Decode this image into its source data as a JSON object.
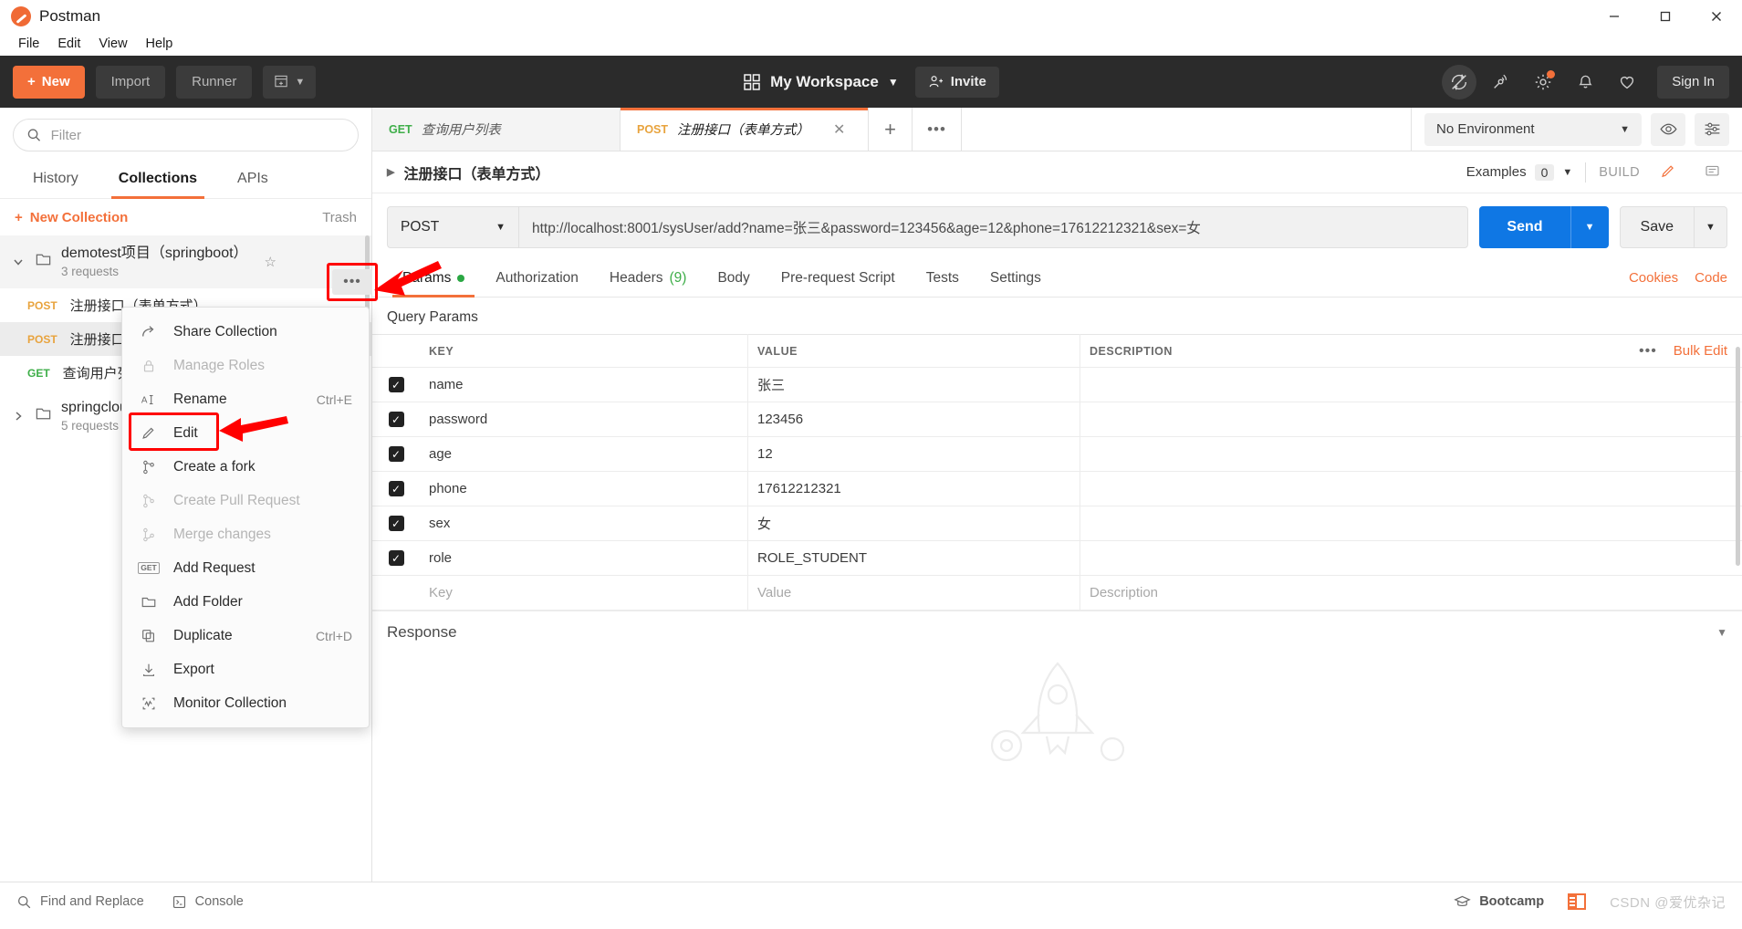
{
  "window": {
    "app_title": "Postman",
    "controls": {
      "minimize": "minimize-icon",
      "maximize": "maximize-icon",
      "close": "close-icon"
    }
  },
  "menubar": {
    "items": [
      "File",
      "Edit",
      "View",
      "Help"
    ]
  },
  "toolbar": {
    "new_label": "New",
    "import_label": "Import",
    "runner_label": "Runner",
    "workspace_label": "My Workspace",
    "invite_label": "Invite",
    "signin_label": "Sign In",
    "icons": [
      "sync-off-icon",
      "satellite-icon",
      "gear-icon",
      "bell-icon",
      "heart-icon"
    ]
  },
  "sidebar": {
    "filter_placeholder": "Filter",
    "tabs": [
      {
        "label": "History",
        "active": false
      },
      {
        "label": "Collections",
        "active": true
      },
      {
        "label": "APIs",
        "active": false
      }
    ],
    "new_collection_label": "New Collection",
    "trash_label": "Trash",
    "collections": [
      {
        "name": "demotest项目（springboot）",
        "requests_count": "3 requests",
        "expanded": true,
        "items": [
          {
            "method": "POST",
            "name": "注册接口（表单方式）"
          },
          {
            "method": "POST",
            "name": "注册接口（json方式）"
          },
          {
            "method": "GET",
            "name": "查询用户列表"
          }
        ]
      },
      {
        "name": "springcloud项目",
        "requests_count": "5 requests",
        "expanded": false,
        "items": []
      }
    ]
  },
  "context_menu": {
    "items": [
      {
        "label": "Share Collection",
        "icon": "share-icon",
        "shortcut": "",
        "disabled": false,
        "highlighted": false
      },
      {
        "label": "Manage Roles",
        "icon": "lock-icon",
        "shortcut": "",
        "disabled": true,
        "highlighted": false
      },
      {
        "label": "Rename",
        "icon": "text-cursor-icon",
        "shortcut": "Ctrl+E",
        "disabled": false,
        "highlighted": false
      },
      {
        "label": "Edit",
        "icon": "pencil-icon",
        "shortcut": "",
        "disabled": false,
        "highlighted": true
      },
      {
        "label": "Create a fork",
        "icon": "fork-icon",
        "shortcut": "",
        "disabled": false,
        "highlighted": false
      },
      {
        "label": "Create Pull Request",
        "icon": "pull-request-icon",
        "shortcut": "",
        "disabled": true,
        "highlighted": false
      },
      {
        "label": "Merge changes",
        "icon": "merge-icon",
        "shortcut": "",
        "disabled": true,
        "highlighted": false
      },
      {
        "label": "Add Request",
        "icon": "get-badge-icon",
        "shortcut": "",
        "disabled": false,
        "highlighted": false
      },
      {
        "label": "Add Folder",
        "icon": "folder-icon",
        "shortcut": "",
        "disabled": false,
        "highlighted": false
      },
      {
        "label": "Duplicate",
        "icon": "copy-icon",
        "shortcut": "Ctrl+D",
        "disabled": false,
        "highlighted": false
      },
      {
        "label": "Export",
        "icon": "download-icon",
        "shortcut": "",
        "disabled": false,
        "highlighted": false
      },
      {
        "label": "Monitor Collection",
        "icon": "monitor-icon",
        "shortcut": "",
        "disabled": false,
        "highlighted": false
      }
    ]
  },
  "main": {
    "request_tabs": [
      {
        "method": "GET",
        "name": "查询用户列表",
        "active": false,
        "closable": false
      },
      {
        "method": "POST",
        "name": "注册接口（表单方式）",
        "active": true,
        "closable": true
      }
    ],
    "add_tab_label": "+",
    "tab_more_label": "•••",
    "environment": {
      "selected": "No Environment"
    },
    "env_icons": [
      "eye-icon",
      "sliders-icon"
    ],
    "breadcrumb": {
      "title": "注册接口（表单方式）"
    },
    "examples": {
      "label": "Examples",
      "count": "0"
    },
    "build_label": "BUILD",
    "request": {
      "method": "POST",
      "url": "http://localhost:8001/sysUser/add?name=张三&password=123456&age=12&phone=17612212321&sex=女",
      "send_label": "Send",
      "save_label": "Save"
    },
    "sub_tabs": [
      {
        "label": "Params",
        "badge": "dot",
        "active": true
      },
      {
        "label": "Authorization",
        "badge": "",
        "active": false
      },
      {
        "label": "Headers",
        "badge": "(9)",
        "active": false
      },
      {
        "label": "Body",
        "badge": "",
        "active": false
      },
      {
        "label": "Pre-request Script",
        "badge": "",
        "active": false
      },
      {
        "label": "Tests",
        "badge": "",
        "active": false
      },
      {
        "label": "Settings",
        "badge": "",
        "active": false
      }
    ],
    "sub_tabs_right": [
      "Cookies",
      "Code"
    ],
    "query_params": {
      "section_title": "Query Params",
      "columns": [
        "KEY",
        "VALUE",
        "DESCRIPTION"
      ],
      "bulk_edit_label": "Bulk Edit",
      "more_label": "•••",
      "rows": [
        {
          "checked": true,
          "key": "name",
          "value": "张三",
          "description": ""
        },
        {
          "checked": true,
          "key": "password",
          "value": "123456",
          "description": ""
        },
        {
          "checked": true,
          "key": "age",
          "value": "12",
          "description": ""
        },
        {
          "checked": true,
          "key": "phone",
          "value": "17612212321",
          "description": ""
        },
        {
          "checked": true,
          "key": "sex",
          "value": "女",
          "description": ""
        },
        {
          "checked": true,
          "key": "role",
          "value": "ROLE_STUDENT",
          "description": ""
        }
      ],
      "empty_row": {
        "key": "Key",
        "value": "Value",
        "description": "Description"
      }
    },
    "response": {
      "title": "Response"
    }
  },
  "statusbar": {
    "find_replace_label": "Find and Replace",
    "console_label": "Console",
    "bootcamp_label": "Bootcamp",
    "watermark": "CSDN @爱优杂记"
  },
  "colors": {
    "accent": "#f3703a",
    "toolbar_bg": "#2b2b2b",
    "send_blue": "#0f77e4",
    "post_orange": "#e8a33d",
    "get_green": "#3eae49",
    "annotation_red": "#ff0000"
  }
}
